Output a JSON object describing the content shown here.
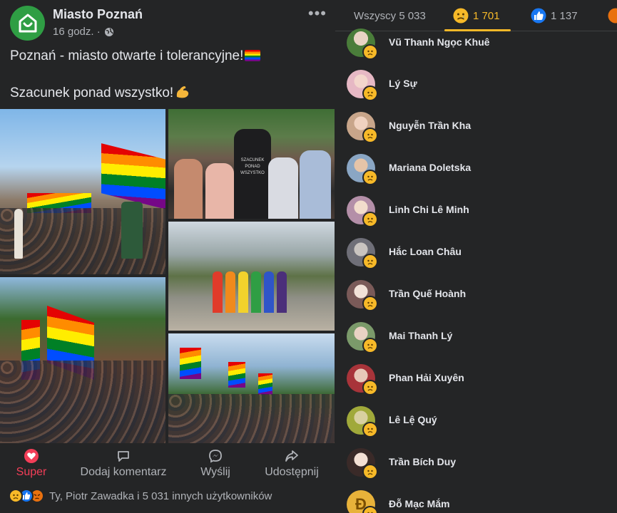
{
  "post": {
    "page_name": "Miasto Poznań",
    "time": "16 godz. ·",
    "text_line1": "Poznań - miasto otwarte i tolerancyjne!",
    "text_line2": "Szacunek ponad wszystko!",
    "more_label": "•••",
    "actions": {
      "react": "Super",
      "comment": "Dodaj komentarz",
      "send": "Wyślij",
      "share": "Udostępnij"
    },
    "summary": "Ty, Piotr Zawadka i 5 031 innych użytkowników",
    "reaction_icons": [
      "sad-icon",
      "like-icon",
      "angry-icon"
    ],
    "photo_sign_text": "SZACUNEK PONAD WSZYSTKO"
  },
  "panel": {
    "tabs": {
      "all": "Wszyscy 5 033",
      "sad": "1 701",
      "like": "1 137"
    },
    "users": [
      {
        "name": "Vũ Thanh Ngọc Khuê",
        "avatar": "#4a7d3a"
      },
      {
        "name": "Lý Sự",
        "avatar": "#e6b8c4"
      },
      {
        "name": "Nguyễn Trần Kha",
        "avatar": "#c8a58a"
      },
      {
        "name": "Mariana Doletska",
        "avatar": "#8aa6c4"
      },
      {
        "name": "Linh Chi Lê Minh",
        "avatar": "#b48fa8"
      },
      {
        "name": "Hắc Loan Châu",
        "avatar": "#6f6f78"
      },
      {
        "name": "Trần Quế Hoành",
        "avatar": "#d8c2b8"
      },
      {
        "name": "Mai Thanh Lý",
        "avatar": "#7b9a6a"
      },
      {
        "name": "Phan Hải Xuyên",
        "avatar": "#a8343a"
      },
      {
        "name": "Lê Lệ Quý",
        "avatar": "#a0a93a"
      },
      {
        "name": "Trần Bích Duy",
        "avatar": "#d6b6a8"
      },
      {
        "name": "Đỗ Mạc Mắm",
        "avatar": "#e8b23a"
      }
    ]
  },
  "colors": {
    "background": "#242526",
    "text": "#e4e6eb",
    "muted": "#b0b3b8",
    "sad": "#f7b928",
    "like": "#1877f2",
    "angry": "#e9710f",
    "super": "#f33e58"
  }
}
